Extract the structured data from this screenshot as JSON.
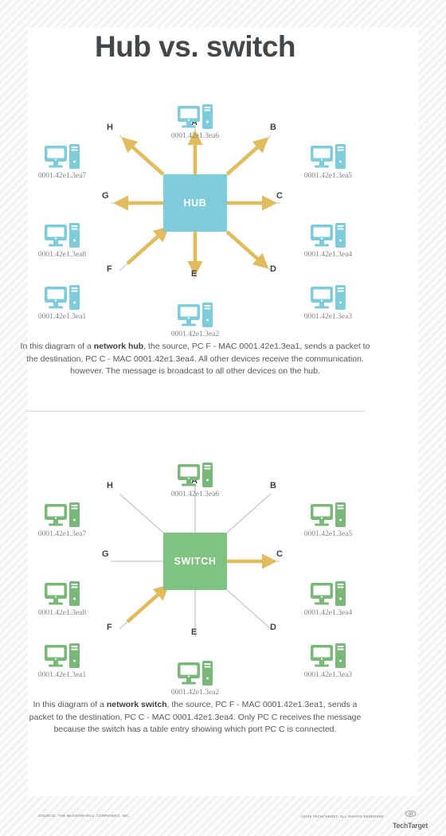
{
  "page": {
    "title": "Hub vs. switch"
  },
  "hub": {
    "center_label": "HUB",
    "box_color": "#7ecbdb",
    "device_color": "#7ecbdb",
    "arrow_color": "#e0bc5e",
    "line_color": "#b9bcbe",
    "nodes": [
      {
        "port": "A",
        "mac": "0001.42e1.3ea6",
        "position": "top"
      },
      {
        "port": "B",
        "mac": "0001.42e1.3ea5",
        "position": "top-right"
      },
      {
        "port": "C",
        "mac": "0001.42e1.3ea4",
        "position": "right"
      },
      {
        "port": "D",
        "mac": "0001.42e1.3ea3",
        "position": "bottom-right"
      },
      {
        "port": "E",
        "mac": "0001.42e1.3ea2",
        "position": "bottom"
      },
      {
        "port": "F",
        "mac": "0001.42e1.3ea1",
        "position": "bottom-left"
      },
      {
        "port": "G",
        "mac": "0001.42e1.3ea8",
        "position": "left"
      },
      {
        "port": "H",
        "mac": "0001.42e1.3ea7",
        "position": "top-left"
      }
    ],
    "caption": {
      "part1": "In this diagram of a ",
      "bold": "network hub",
      "part2": ", the source, PC F - MAC 0001.42e1.3ea1, sends a packet to the destination, PC C - MAC 0001.42e1.3ea4. All other devices receive the communication. however. The message is broadcast to all other devices on the hub."
    }
  },
  "switch": {
    "center_label": "SWITCH",
    "box_color": "#80c280",
    "device_color": "#7ab87a",
    "arrow_color": "#e0bc5e",
    "line_color": "#b9bcbe",
    "nodes": [
      {
        "port": "A",
        "mac": "0001.42e1.3ea6",
        "position": "top"
      },
      {
        "port": "B",
        "mac": "0001.42e1.3ea5",
        "position": "top-right"
      },
      {
        "port": "C",
        "mac": "0001.42e1.3ea4",
        "position": "right"
      },
      {
        "port": "D",
        "mac": "0001.42e1.3ea3",
        "position": "bottom-right"
      },
      {
        "port": "E",
        "mac": "0001.42e1.3ea2",
        "position": "bottom"
      },
      {
        "port": "F",
        "mac": "0001.42e1.3ea1",
        "position": "bottom-left"
      },
      {
        "port": "G",
        "mac": "0001.42e1.3ea8",
        "position": "left"
      },
      {
        "port": "H",
        "mac": "0001.42e1.3ea7",
        "position": "top-left"
      }
    ],
    "caption": {
      "part1": "In this diagram of a ",
      "bold": "network switch",
      "part2": ", the source, PC F - MAC 0001.42e1.3ea1, sends a packet to the destination, PC C - MAC 0001.42e1.3ea4. Only PC C receives the message because the switch has a table entry showing which port PC C is connected."
    }
  },
  "footer": {
    "source": "SOURCE: THE McGRAW-HILL COMPANIES, INC.",
    "copyright": "©2019 TECHTARGET. ALL RIGHTS RESERVED",
    "logo_name": "TechTarget"
  }
}
